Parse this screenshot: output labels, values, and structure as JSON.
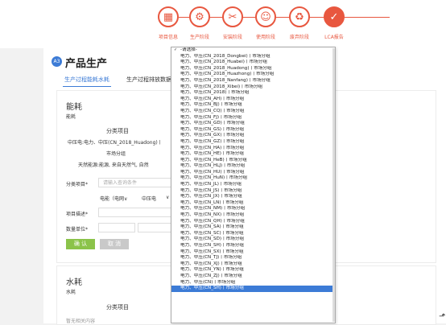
{
  "steps": [
    {
      "label": "项目信息",
      "icon": "calendar-icon",
      "done": false
    },
    {
      "label": "生产阶段",
      "icon": "gear-icon",
      "done": false
    },
    {
      "label": "安装阶段",
      "icon": "tools-icon",
      "done": false
    },
    {
      "label": "使用阶段",
      "icon": "user-icon",
      "done": false
    },
    {
      "label": "废弃阶段",
      "icon": "recycle-icon",
      "done": false
    },
    {
      "label": "LCA报告",
      "icon": "check-icon",
      "done": true
    }
  ],
  "page": {
    "badge": "A3",
    "title": "产品生产",
    "tabs": [
      "生产过程能耗水耗",
      "生产过程排放数据"
    ]
  },
  "energy": {
    "title": "能耗",
    "subtitle": "能耗",
    "category_header": "分类项目",
    "row1": "中压电:电力、中压(CN_2018_Huadong)丨",
    "row2": "市场分组",
    "row3": "天然能源:能源, 来自天然气, 自然",
    "form": {
      "category_label": "分类项目*",
      "search_placeholder": "请输入查询条件",
      "select1": "电能（电网∨",
      "select2": "中压电",
      "desc_label": "项目描述*",
      "unit_label": "数量单位*",
      "confirm": "确 认",
      "cancel": "取 消"
    }
  },
  "water": {
    "title": "水耗",
    "subtitle": "水耗",
    "category_header": "分类项目",
    "empty": "暂无相关内容"
  },
  "dropdown": {
    "placeholder_option": "-请选择-",
    "selected_index": 38,
    "options": [
      "电力、中压(CN_2018_Dongbei)丨市场分组",
      "电力、中压(CN_2018_Huabei)丨市场分组",
      "电力、中压(CN_2018_Huadong)丨市场分组",
      "电力、中压(CN_2018_Huazhong)丨市场分组",
      "电力、中压(CN_2018_Nanfang)丨市场分组",
      "电力、中压(CN_2018_Xibei)丨市场分组",
      "电力、中压(CN_2018)丨市场分组",
      "电力、中压(CN_AH)丨市场分组",
      "电力、中压(CN_BJ)丨市场分组",
      "电力、中压(CN_CQ)丨市场分组",
      "电力、中压(CN_FJ)丨市场分组",
      "电力、中压(CN_GD)丨市场分组",
      "电力、中压(CN_GS)丨市场分组",
      "电力、中压(CN_GX)丨市场分组",
      "电力、中压(CN_GZ)丨市场分组",
      "电力、中压(CN_HA)丨市场分组",
      "电力、中压(CN_HE)丨市场分组",
      "电力、中压(CN_HeB)丨市场分组",
      "电力、中压(CN_HLJ)丨市场分组",
      "电力、中压(CN_HU)丨市场分组",
      "电力、中压(CN_HuN)丨市场分组",
      "电力、中压(CN_JL)丨市场分组",
      "电力、中压(CN_JS)丨市场分组",
      "电力、中压(CN_JX)丨市场分组",
      "电力、中压(CN_LN)丨市场分组",
      "电力、中压(CN_NM)丨市场分组",
      "电力、中压(CN_NX)丨市场分组",
      "电力、中压(CN_QH)丨市场分组",
      "电力、中压(CN_SA)丨市场分组",
      "电力、中压(CN_SC)丨市场分组",
      "电力、中压(CN_SD)丨市场分组",
      "电力、中压(CN_SH)丨市场分组",
      "电力、中压(CN_SX)丨市场分组",
      "电力、中压(CN_TJ)丨市场分组",
      "电力、中压(CN_XJ)丨市场分组",
      "电力、中压(CN_YN)丨市场分组",
      "电力、中压(CN_ZJ)丨市场分组",
      "电力、中压(CN)丨市场分组",
      "电力、中压(CN_SH)丨市场分组"
    ]
  }
}
